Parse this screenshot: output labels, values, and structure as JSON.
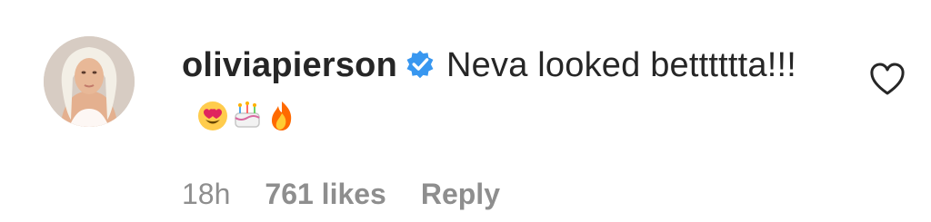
{
  "comment": {
    "username": "oliviapierson",
    "text": "Neva looked betttttta!!!",
    "emojis": [
      "😍",
      "🎂",
      "🔥"
    ],
    "verified": true,
    "time": "18h",
    "likes": "761 likes",
    "reply_label": "Reply"
  },
  "icons": {
    "avatar": "user-avatar",
    "verified": "verified-badge-icon",
    "like": "heart-outline-icon"
  },
  "colors": {
    "text": "#262626",
    "meta": "#8e8e8e",
    "verified": "#3897f0"
  }
}
